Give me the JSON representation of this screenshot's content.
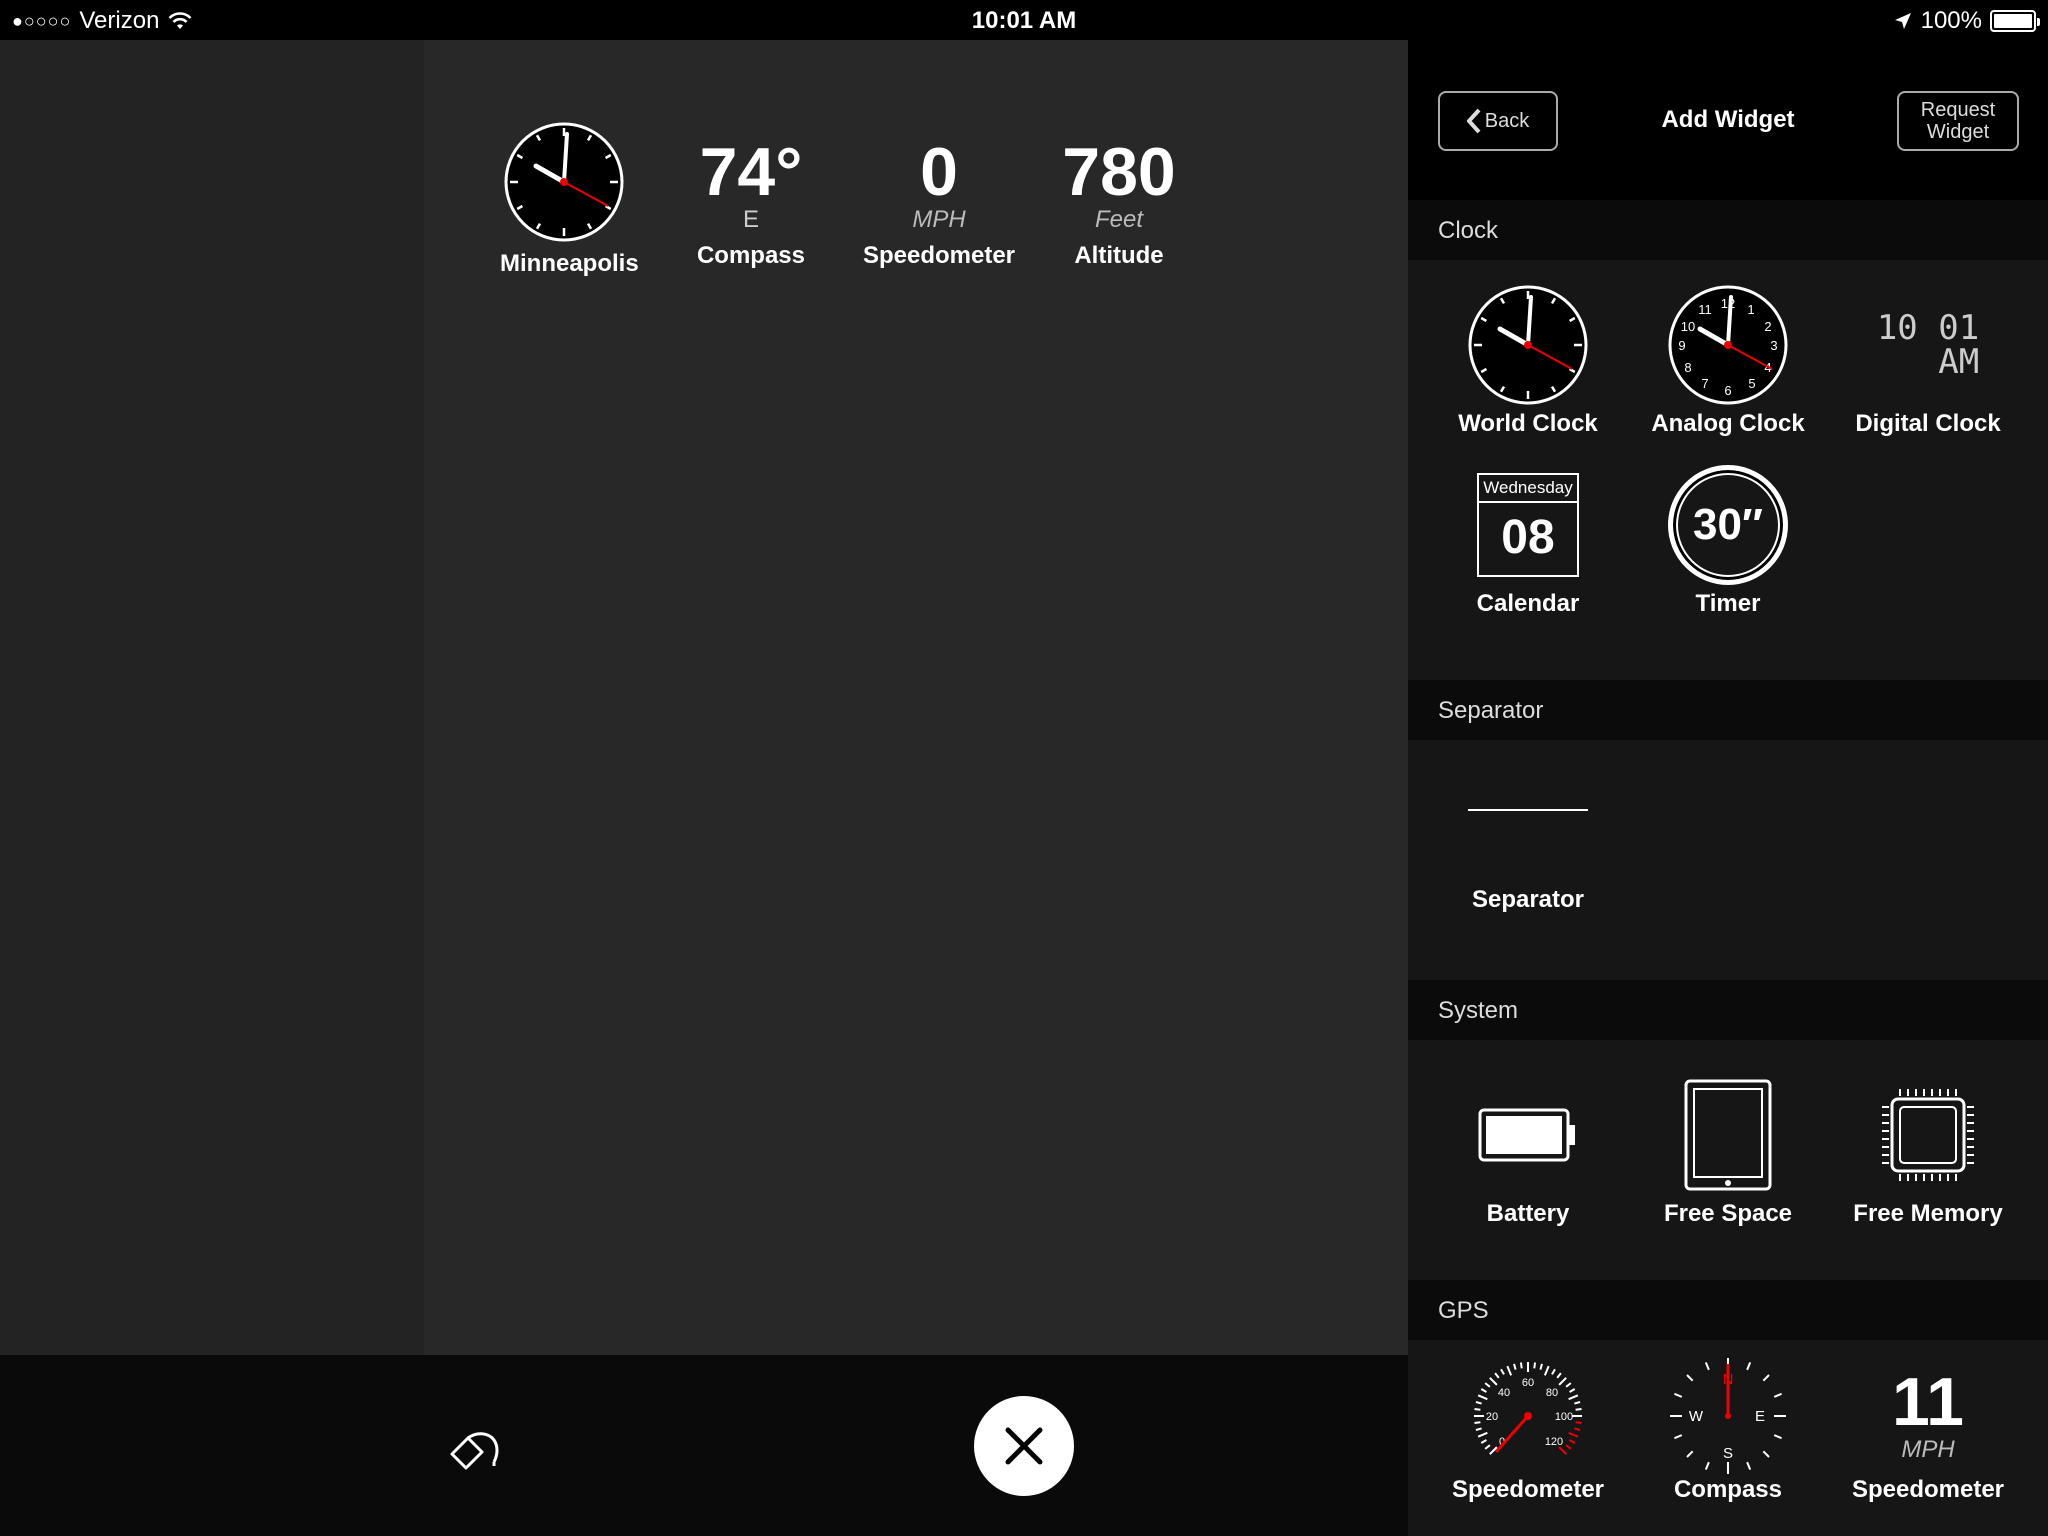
{
  "status_bar": {
    "signal": "●○○○○",
    "carrier": "Verizon",
    "time": "10:01 AM",
    "battery": "100%"
  },
  "dashboard_widgets": [
    {
      "label": "Minneapolis"
    },
    {
      "label": "Compass",
      "value": "74°",
      "sub": "E"
    },
    {
      "label": "Speedometer",
      "value": "0",
      "sub": "MPH"
    },
    {
      "label": "Altitude",
      "value": "780",
      "sub": "Feet"
    }
  ],
  "panel": {
    "back_label": "Back",
    "title": "Add Widget",
    "request_line1": "Request",
    "request_line2": "Widget"
  },
  "sections": {
    "clock": {
      "title": "Clock",
      "items": [
        "World Clock",
        "Analog Clock",
        "Digital Clock",
        "Calendar",
        "Timer"
      ],
      "digital_time_line1": "10 01",
      "digital_time_line2": "AM",
      "calendar_day": "Wednesday",
      "calendar_date": "08",
      "timer_text": "30″"
    },
    "separator": {
      "title": "Separator",
      "items": [
        "Separator"
      ]
    },
    "system": {
      "title": "System",
      "items": [
        "Battery",
        "Free Space",
        "Free Memory"
      ]
    },
    "gps": {
      "title": "GPS",
      "items": [
        "Speedometer",
        "Compass",
        "Speedometer"
      ],
      "speed_value": "11",
      "speed_unit": "MPH",
      "gauge_labels": [
        "0",
        "20",
        "40",
        "60",
        "80",
        "100",
        "120"
      ],
      "compass_labels": [
        "N",
        "E",
        "S",
        "W"
      ]
    }
  }
}
